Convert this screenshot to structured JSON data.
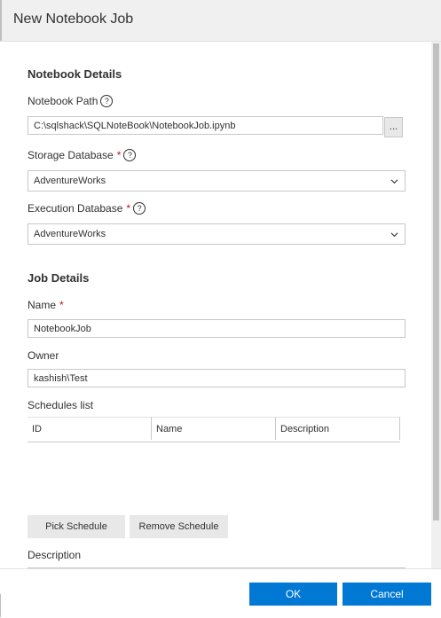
{
  "dialog": {
    "title": "New Notebook Job"
  },
  "notebook_details": {
    "heading": "Notebook Details",
    "path_label": "Notebook Path",
    "path_value": "C:\\sqlshack\\SQLNoteBook\\NotebookJob.ipynb",
    "browse_label": "...",
    "storage_db_label": "Storage Database",
    "storage_db_value": "AdventureWorks",
    "execution_db_label": "Execution Database",
    "execution_db_value": "AdventureWorks",
    "required_mark": "*",
    "help_glyph": "?"
  },
  "job_details": {
    "heading": "Job Details",
    "name_label": "Name",
    "name_value": "NotebookJob",
    "owner_label": "Owner",
    "owner_value": "kashish\\Test",
    "schedules_label": "Schedules list",
    "schedule_columns": [
      "ID",
      "Name",
      "Description"
    ],
    "pick_schedule_label": "Pick Schedule",
    "remove_schedule_label": "Remove Schedule",
    "description_label": "Description"
  },
  "footer": {
    "ok_label": "OK",
    "cancel_label": "Cancel"
  },
  "colors": {
    "primary_button": "#0078d4",
    "required": "#c50f1f"
  }
}
